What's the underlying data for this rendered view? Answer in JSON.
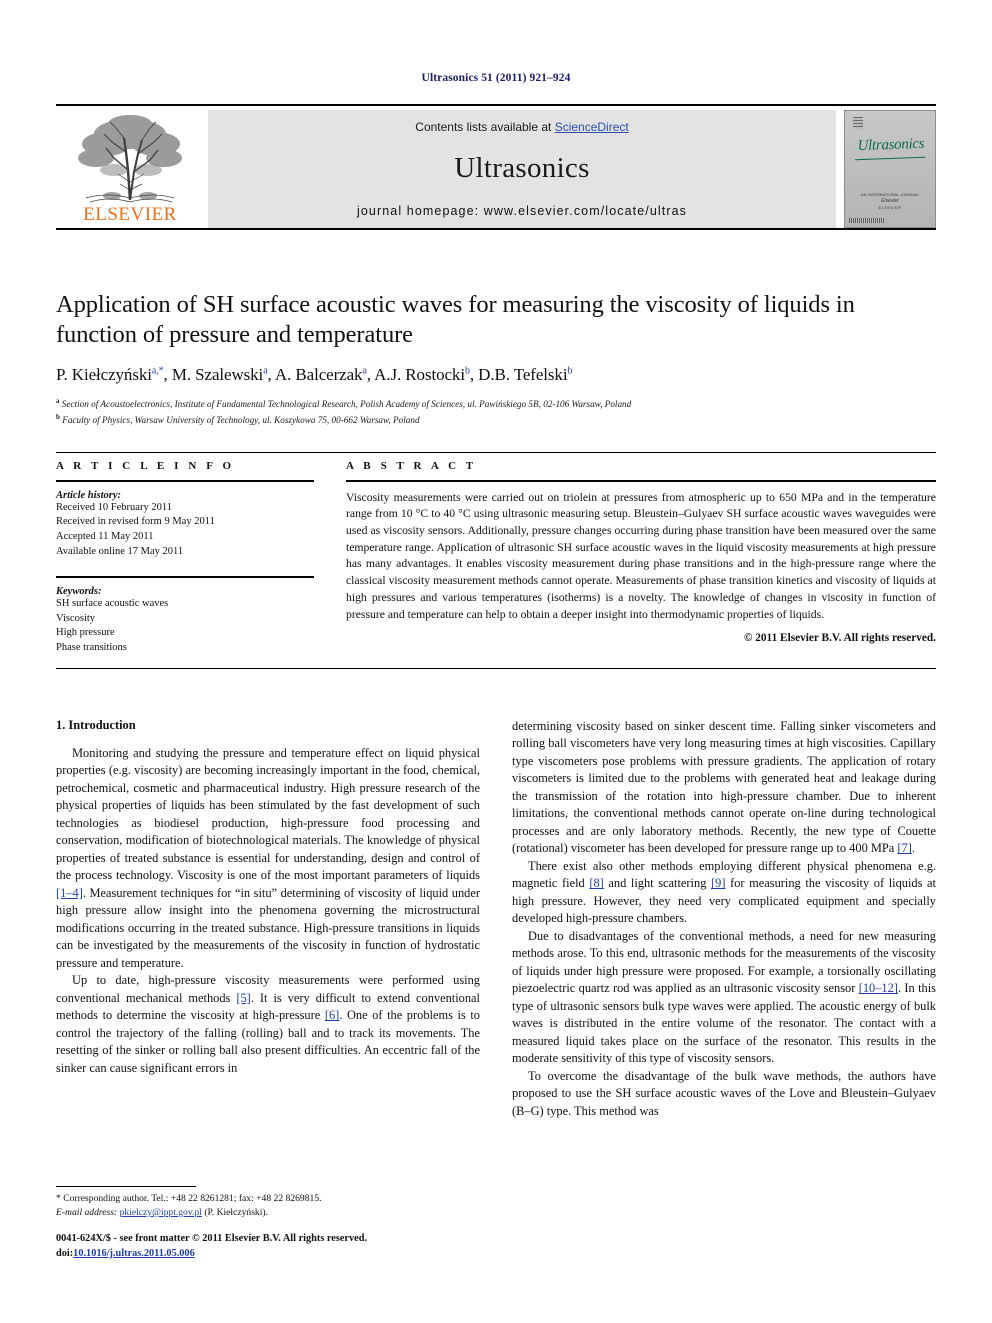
{
  "running_head": "Ultrasonics 51 (2011) 921–924",
  "masthead": {
    "contents_prefix": "Contents lists available at ",
    "sciencedirect": "ScienceDirect",
    "journal_name": "Ultrasonics",
    "homepage": "journal homepage: www.elsevier.com/locate/ultras",
    "publisher": "ELSEVIER",
    "cover_title": "Ultrasonics",
    "cover_footer": "AN INTERNATIONAL JOURNAL\nELSEVIER",
    "sciencedirect_color": "#2b4db3",
    "elsevier_orange": "#e8731a",
    "banner_bg": "#e3e3e3"
  },
  "article": {
    "title": "Application of SH surface acoustic waves for measuring the viscosity of liquids in function of pressure and temperature",
    "authors": [
      {
        "name": "P. Kiełczyński",
        "marks": "a,*"
      },
      {
        "name": "M. Szalewski",
        "marks": "a"
      },
      {
        "name": "A. Balcerzak",
        "marks": "a"
      },
      {
        "name": "A.J. Rostocki",
        "marks": "b"
      },
      {
        "name": "D.B. Tefelski",
        "marks": "b"
      }
    ],
    "affiliations": [
      {
        "mark": "a",
        "text": "Section of Acoustoelectronics, Institute of Fundamental Technological Research, Polish Academy of Sciences, ul. Pawińskiego 5B, 02-106 Warsaw, Poland"
      },
      {
        "mark": "b",
        "text": "Faculty of Physics, Warsaw University of Technology, ul. Koszykowa 75, 00-662 Warsaw, Poland"
      }
    ]
  },
  "article_info": {
    "label": "A R T I C L E   I N F O",
    "history_heading": "Article history:",
    "history": [
      "Received 10 February 2011",
      "Received in revised form 9 May 2011",
      "Accepted 11 May 2011",
      "Available online 17 May 2011"
    ],
    "keywords_heading": "Keywords:",
    "keywords": [
      "SH surface acoustic waves",
      "Viscosity",
      "High pressure",
      "Phase transitions"
    ]
  },
  "abstract": {
    "label": "A B S T R A C T",
    "text": "Viscosity measurements were carried out on triolein at pressures from atmospheric up to 650 MPa and in the temperature range from 10 °C to 40 °C using ultrasonic measuring setup. Bleustein–Gulyaev SH surface acoustic waves waveguides were used as viscosity sensors. Additionally, pressure changes occurring during phase transition have been measured over the same temperature range. Application of ultrasonic SH surface acoustic waves in the liquid viscosity measurements at high pressure has many advantages. It enables viscosity measurement during phase transitions and in the high-pressure range where the classical viscosity measurement methods cannot operate. Measurements of phase transition kinetics and viscosity of liquids at high pressures and various temperatures (isotherms) is a novelty. The knowledge of changes in viscosity in function of pressure and temperature can help to obtain a deeper insight into thermodynamic properties of liquids.",
    "copyright": "© 2011 Elsevier B.V. All rights reserved."
  },
  "body": {
    "section_title": "1. Introduction",
    "left_paragraphs": [
      {
        "parts": [
          {
            "t": "Monitoring and studying the pressure and temperature effect on liquid physical properties (e.g. viscosity) are becoming increasingly important in the food, chemical, petrochemical, cosmetic and pharmaceutical industry. High pressure research of the physical properties of liquids has been stimulated by the fast development of such technologies as biodiesel production, high-pressure food processing and conservation, modification of biotechnological materials. The knowledge of physical properties of treated substance is essential for understanding, design and control of the process technology. Viscosity is one of the most important parameters of liquids "
          },
          {
            "t": "[1–4]",
            "cite": true
          },
          {
            "t": ". Measurement techniques for “in situ” determining of viscosity of liquid under high pressure allow insight into the phenomena governing the microstructural modifications occurring in the treated substance. High-pressure transitions in liquids can be investigated by the measurements of the viscosity in function of hydrostatic pressure and temperature."
          }
        ]
      },
      {
        "parts": [
          {
            "t": "Up to date, high-pressure viscosity measurements were performed using conventional mechanical methods "
          },
          {
            "t": "[5]",
            "cite": true
          },
          {
            "t": ". It is very difficult to extend conventional methods to determine the viscosity at high-pressure "
          },
          {
            "t": "[6]",
            "cite": true
          },
          {
            "t": ". One of the problems is to control the trajectory of the falling (rolling) ball and to track its movements. The resetting of the sinker or rolling ball also present difficulties. An eccentric fall of the sinker can cause significant errors in"
          }
        ]
      }
    ],
    "right_paragraphs": [
      {
        "noindent": true,
        "parts": [
          {
            "t": "determining viscosity based on sinker descent time. Falling sinker viscometers and rolling ball viscometers have very long measuring times at high viscosities. Capillary type viscometers pose problems with pressure gradients. The application of rotary viscometers is limited due to the problems with generated heat and leakage during the transmission of the rotation into high-pressure chamber. Due to inherent limitations, the conventional methods cannot operate on-line during technological processes and are only laboratory methods. Recently, the new type of Couette (rotational) viscometer has been developed for pressure range up to 400 MPa "
          },
          {
            "t": "[7]",
            "cite": true
          },
          {
            "t": "."
          }
        ]
      },
      {
        "parts": [
          {
            "t": "There exist also other methods employing different physical phenomena e.g. magnetic field "
          },
          {
            "t": "[8]",
            "cite": true
          },
          {
            "t": " and light scattering "
          },
          {
            "t": "[9]",
            "cite": true
          },
          {
            "t": " for measuring the viscosity of liquids at high pressure. However, they need very complicated equipment and specially developed high-pressure chambers."
          }
        ]
      },
      {
        "parts": [
          {
            "t": "Due to disadvantages of the conventional methods, a need for new measuring methods arose. To this end, ultrasonic methods for the measurements of the viscosity of liquids under high pressure were proposed. For example, a torsionally oscillating piezoelectric quartz rod was applied as an ultrasonic viscosity sensor "
          },
          {
            "t": "[10–12]",
            "cite": true
          },
          {
            "t": ". In this type of ultrasonic sensors bulk type waves were applied. The acoustic energy of bulk waves is distributed in the entire volume of the resonator. The contact with a measured liquid takes place on the surface of the resonator. This results in the moderate sensitivity of this type of viscosity sensors."
          }
        ]
      },
      {
        "parts": [
          {
            "t": "To overcome the disadvantage of the bulk wave methods, the authors have proposed to use the SH surface acoustic waves of the Love and Bleustein–Gulyaev (B–G) type. This method was"
          }
        ]
      }
    ]
  },
  "footnote": {
    "corresponding": "* Corresponding author. Tel.: +48 22 8261281; fax: +48 22 8269815.",
    "email_label": "E-mail address:",
    "email": "pkielczy@ippt.gov.pl",
    "email_owner": "(P. Kiełczyński)."
  },
  "footer": {
    "issn_line": "0041-624X/$ - see front matter © 2011 Elsevier B.V. All rights reserved.",
    "doi_label": "doi:",
    "doi": "10.1016/j.ultras.2011.05.006"
  }
}
